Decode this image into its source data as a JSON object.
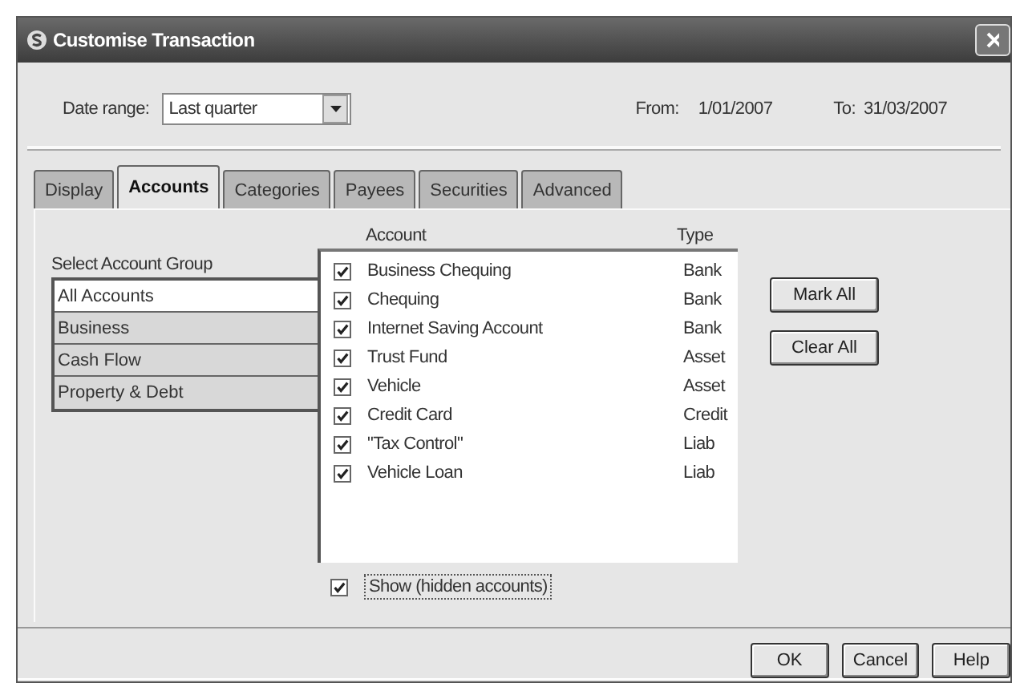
{
  "window": {
    "title": "Customise Transaction"
  },
  "date_range": {
    "label": "Date range:",
    "value": "Last quarter",
    "from_label": "From:",
    "from": "1/01/2007",
    "to_label": "To:",
    "to": "31/03/2007"
  },
  "tabs": [
    {
      "label": "Display",
      "selected": false
    },
    {
      "label": "Accounts",
      "selected": true
    },
    {
      "label": "Categories",
      "selected": false
    },
    {
      "label": "Payees",
      "selected": false
    },
    {
      "label": "Securities",
      "selected": false
    },
    {
      "label": "Advanced",
      "selected": false
    }
  ],
  "account_groups": {
    "label": "Select Account Group",
    "items": [
      {
        "label": "All Accounts",
        "selected": true
      },
      {
        "label": "Business",
        "selected": false
      },
      {
        "label": "Cash Flow",
        "selected": false
      },
      {
        "label": "Property & Debt",
        "selected": false
      }
    ]
  },
  "accounts": {
    "columns": [
      "Account",
      "Type"
    ],
    "rows": [
      {
        "name": "Business Chequing",
        "type": "Bank",
        "checked": true
      },
      {
        "name": "Chequing",
        "type": "Bank",
        "checked": true
      },
      {
        "name": "Internet Saving Account",
        "type": "Bank",
        "checked": true
      },
      {
        "name": "Trust Fund",
        "type": "Asset",
        "checked": true
      },
      {
        "name": "Vehicle",
        "type": "Asset",
        "checked": true
      },
      {
        "name": "Credit Card",
        "type": "Credit",
        "checked": true
      },
      {
        "name": "\"Tax Control\"",
        "type": "Liab",
        "checked": true
      },
      {
        "name": "Vehicle Loan",
        "type": "Liab",
        "checked": true
      }
    ]
  },
  "side_buttons": [
    "Mark All",
    "Clear All"
  ],
  "show_hidden": {
    "label": "Show (hidden accounts)",
    "checked": true
  },
  "buttons": [
    "OK",
    "Cancel",
    "Help"
  ]
}
